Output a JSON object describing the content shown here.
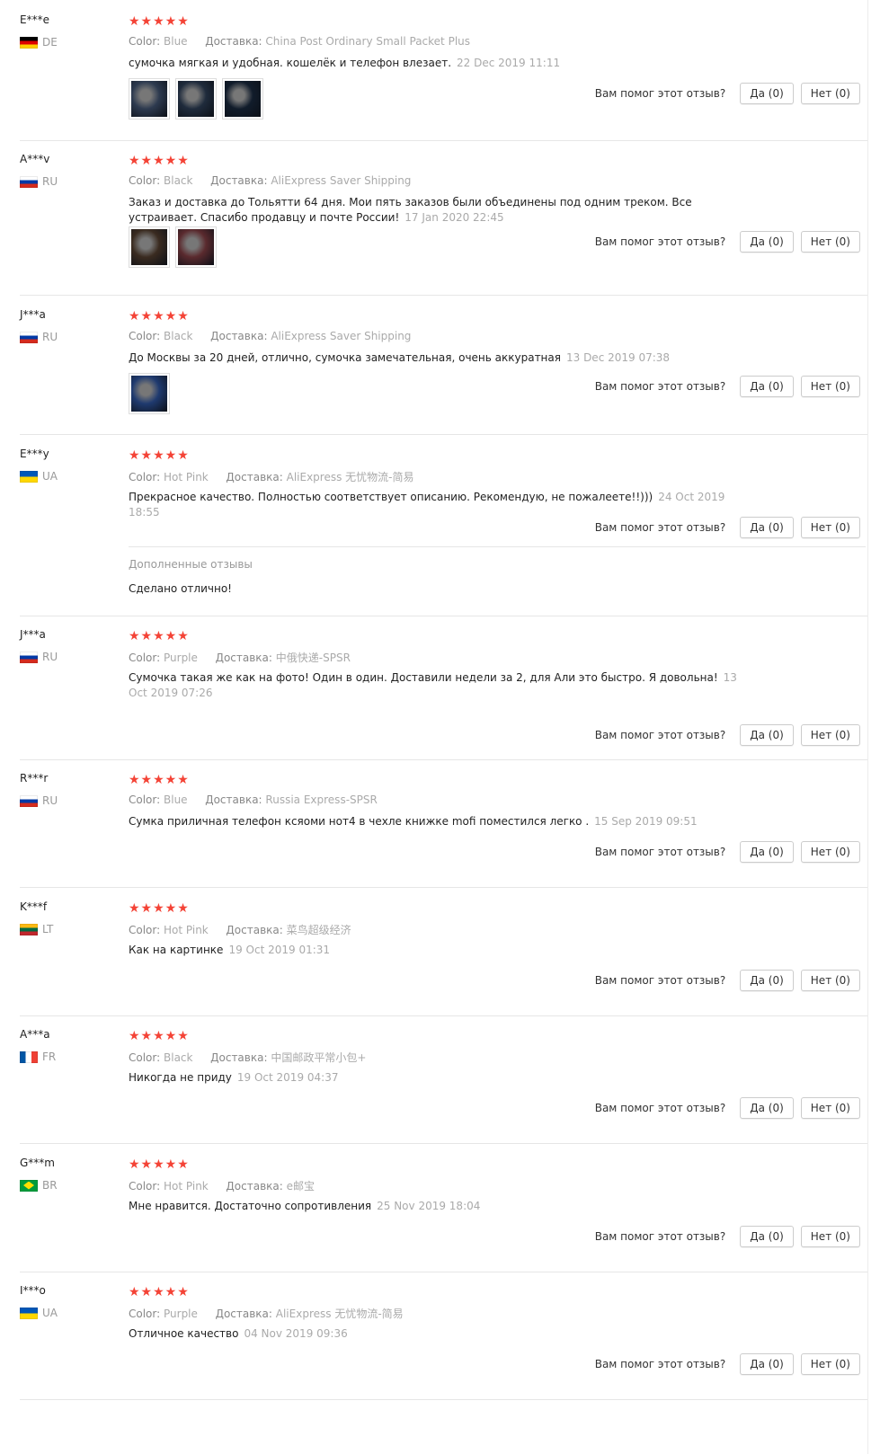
{
  "helpful_question": "Вам помог этот отзыв?",
  "stars_glyph": "★★★★★",
  "reviews": [
    {
      "user": "E***e",
      "country": "DE",
      "color_label": "Color:",
      "color": "Blue",
      "shipping_label": "Доставка:",
      "shipping": "China Post Ordinary Small Packet Plus",
      "text": "сумочка мягкая и удобная. кошелёк и телефон влезает.",
      "date": "22 Dec 2019 11:11",
      "photo_count": 3,
      "yes": "Да (0)",
      "no": "Нет (0)"
    },
    {
      "user": "A***v",
      "country": "RU",
      "color_label": "Color:",
      "color": "Black",
      "shipping_label": "Доставка:",
      "shipping": "AliExpress Saver Shipping",
      "text": "Заказ и доставка до Тольятти 64 дня. Мои пять заказов были объединены под одним треком. Все устраивает. Спасибо продавцу и почте России!",
      "date": "17 Jan 2020 22:45",
      "photo_count": 2,
      "yes": "Да (0)",
      "no": "Нет (0)"
    },
    {
      "user": "J***a",
      "country": "RU",
      "color_label": "Color:",
      "color": "Black",
      "shipping_label": "Доставка:",
      "shipping": "AliExpress Saver Shipping",
      "text": "До Москвы за 20 дней, отлично, сумочка замечательная, очень аккуратная",
      "date": "13 Dec 2019 07:38",
      "photo_count": 1,
      "yes": "Да (0)",
      "no": "Нет (0)"
    },
    {
      "user": "E***y",
      "country": "UA",
      "color_label": "Color:",
      "color": "Hot Pink",
      "shipping_label": "Доставка:",
      "shipping": "AliExpress 无忧物流-简易",
      "text": "Прекрасное качество. Полностью соответствует описанию. Рекомендую, не пожалеете!!)))",
      "date": "24 Oct 2019 18:55",
      "photo_count": 0,
      "yes": "Да (0)",
      "no": "Нет (0)",
      "additional_title": "Дополненные отзывы",
      "additional_text": "Сделано отлично!"
    },
    {
      "user": "J***a",
      "country": "RU",
      "color_label": "Color:",
      "color": "Purple",
      "shipping_label": "Доставка:",
      "shipping": "中俄快递-SPSR",
      "text": "Сумочка такая же как на фото! Один в один. Доставили недели за 2, для Али это быстро. Я довольна!",
      "date": "13 Oct 2019 07:26",
      "photo_count": 0,
      "yes": "Да (0)",
      "no": "Нет (0)"
    },
    {
      "user": "R***r",
      "country": "RU",
      "color_label": "Color:",
      "color": "Blue",
      "shipping_label": "Доставка:",
      "shipping": "Russia Express-SPSR",
      "text": "Сумка приличная телефон ксяоми нот4 в чехле книжке mofi поместился легко .",
      "date": "15 Sep 2019 09:51",
      "photo_count": 0,
      "yes": "Да (0)",
      "no": "Нет (0)"
    },
    {
      "user": "K***f",
      "country": "LT",
      "color_label": "Color:",
      "color": "Hot Pink",
      "shipping_label": "Доставка:",
      "shipping": "菜鸟超级经济",
      "text": "Как на картинке",
      "date": "19 Oct 2019 01:31",
      "photo_count": 0,
      "yes": "Да (0)",
      "no": "Нет (0)"
    },
    {
      "user": "A***a",
      "country": "FR",
      "color_label": "Color:",
      "color": "Black",
      "shipping_label": "Доставка:",
      "shipping": "中国邮政平常小包+",
      "text": "Никогда не приду",
      "date": "19 Oct 2019 04:37",
      "photo_count": 0,
      "yes": "Да (0)",
      "no": "Нет (0)"
    },
    {
      "user": "G***m",
      "country": "BR",
      "color_label": "Color:",
      "color": "Hot Pink",
      "shipping_label": "Доставка:",
      "shipping": "e邮宝",
      "text": "Мне нравится. Достаточно сопротивления",
      "date": "25 Nov 2019 18:04",
      "photo_count": 0,
      "yes": "Да (0)",
      "no": "Нет (0)"
    },
    {
      "user": "I***o",
      "country": "UA",
      "color_label": "Color:",
      "color": "Purple",
      "shipping_label": "Доставка:",
      "shipping": "AliExpress 无忧物流-简易",
      "text": "Отличное качество",
      "date": "04 Nov 2019 09:36",
      "photo_count": 0,
      "yes": "Да (0)",
      "no": "Нет (0)"
    }
  ]
}
